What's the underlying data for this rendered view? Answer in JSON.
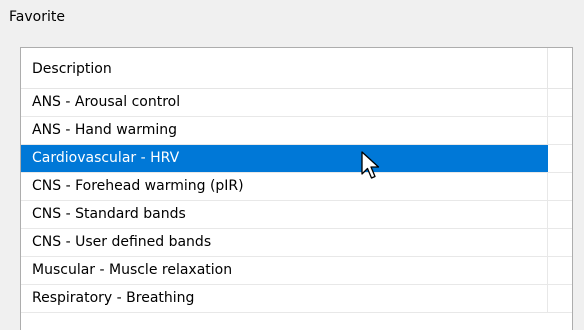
{
  "group": {
    "label": "Favorite"
  },
  "list": {
    "column_header": "Description",
    "items": [
      {
        "label": "ANS - Arousal control",
        "selected": false
      },
      {
        "label": "ANS - Hand warming",
        "selected": false
      },
      {
        "label": "Cardiovascular - HRV",
        "selected": true
      },
      {
        "label": "CNS - Forehead warming (pIR)",
        "selected": false
      },
      {
        "label": "CNS - Standard bands",
        "selected": false
      },
      {
        "label": "CNS - User defined bands",
        "selected": false
      },
      {
        "label": "Muscular - Muscle relaxation",
        "selected": false
      },
      {
        "label": "Respiratory - Breathing",
        "selected": false
      }
    ]
  },
  "colors": {
    "selection": "#0078d7",
    "window_background": "#f0f0f0"
  },
  "cursor": {
    "icon": "arrow-cursor-icon"
  }
}
